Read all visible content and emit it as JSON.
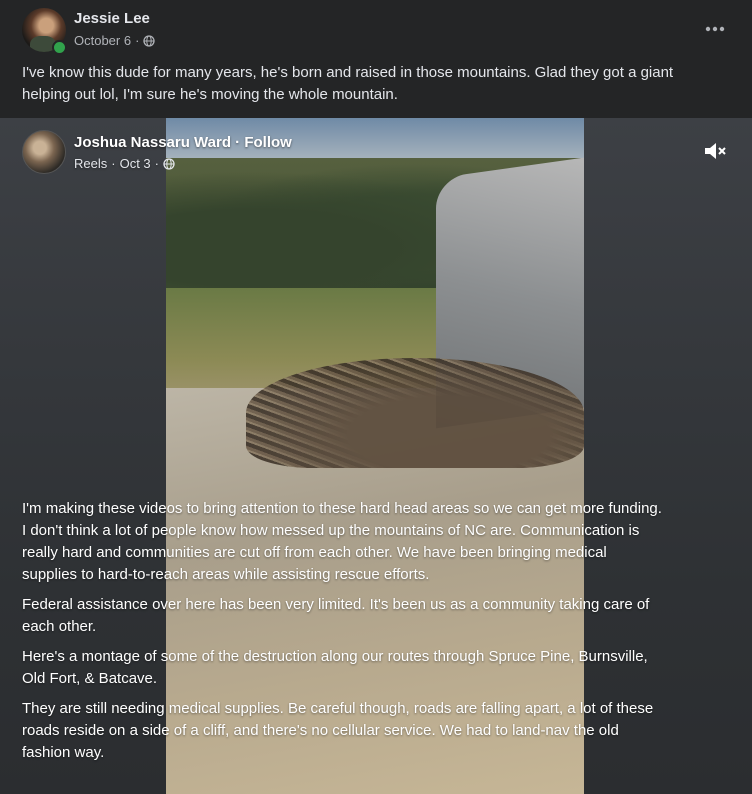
{
  "post": {
    "author": "Jessie Lee",
    "date": "October 6",
    "separator": "·",
    "text": "I've know this dude for many years, he's born and raised in those mountains. Glad they got a giant helping out lol, I'm sure he's moving the whole mountain.",
    "more_icon": "more-options-icon",
    "privacy_icon": "globe-icon"
  },
  "shared": {
    "author": "Joshua Nassaru Ward",
    "dot": " · ",
    "follow_label": "Follow",
    "source": "Reels",
    "date": "Oct 3",
    "separator": "·",
    "privacy_icon": "globe-icon",
    "mute_icon": "muted-speaker-icon",
    "paragraphs": [
      "I'm making these videos to bring attention to these hard head areas so we can get more funding. I don't think a lot of people know how messed up the mountains of NC are. Communication is really hard and communities are cut off from each other. We have been bringing medical supplies to hard-to-reach areas while assisting rescue efforts.",
      "Federal assistance over here has been very limited. It's been us as a community taking care of each other.",
      "Here's a montage of some of the destruction along our routes through Spruce Pine, Burnsville, Old Fort, & Batcave.",
      "They are still needing medical supplies. Be careful though, roads are falling apart, a lot of these roads reside on a side of a cliff, and there's no cellular service. We had to land-nav the old fashion way."
    ]
  },
  "colors": {
    "background": "#242526",
    "text_primary": "#e4e6eb",
    "text_secondary": "#b0b3b8",
    "online": "#31a24c"
  }
}
